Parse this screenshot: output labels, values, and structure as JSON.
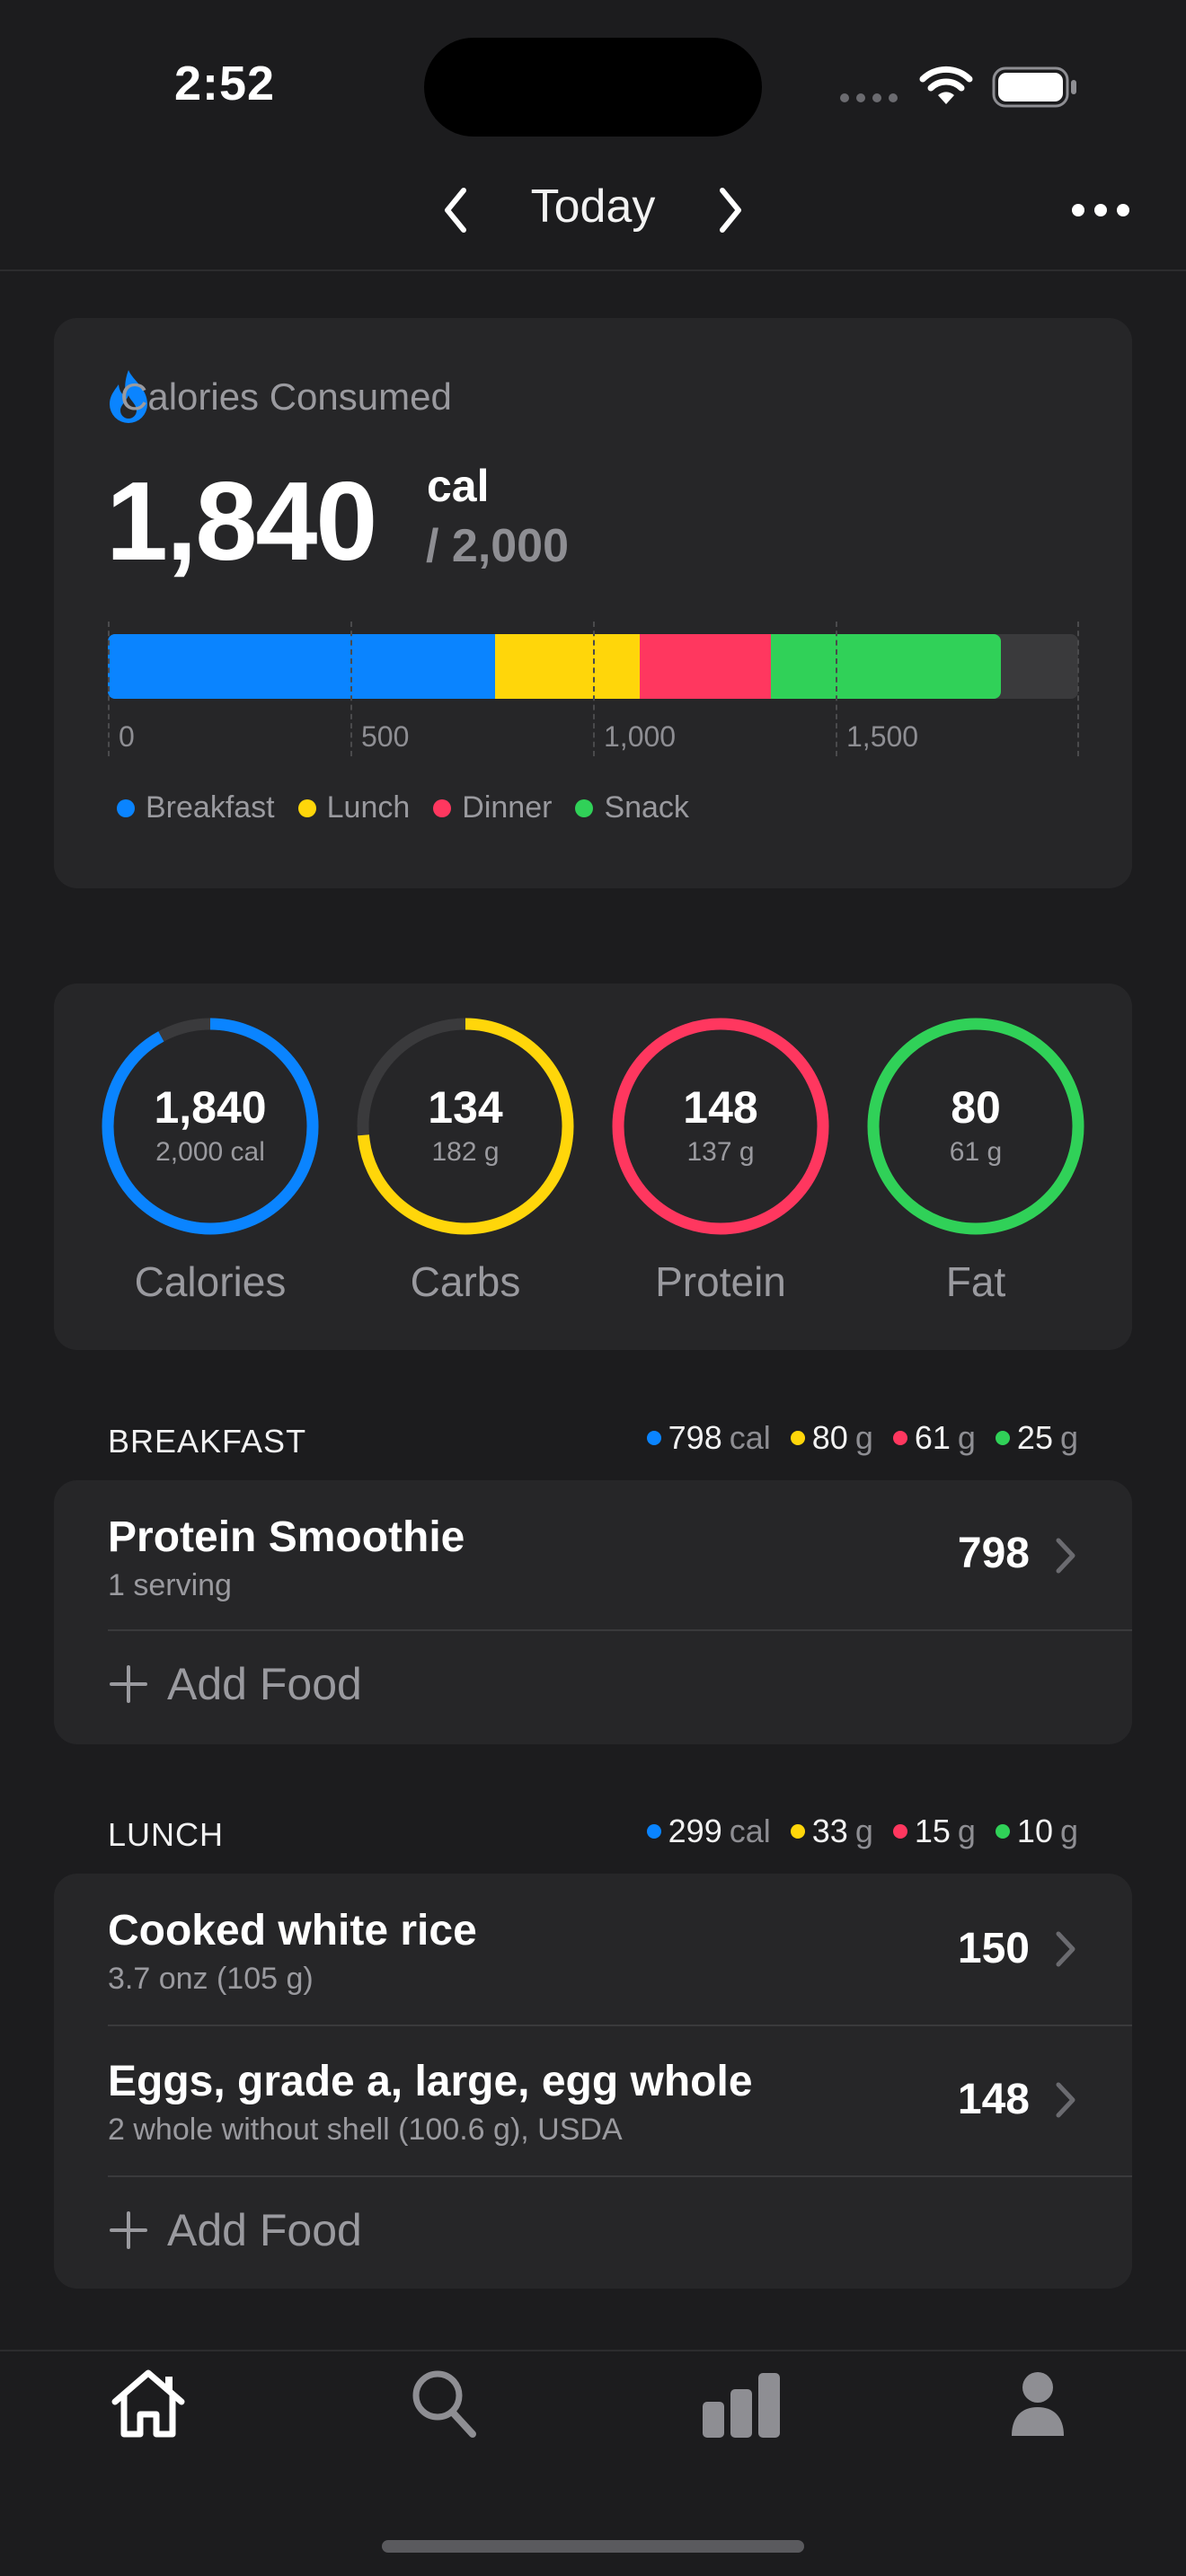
{
  "status_bar": {
    "time": "2:52"
  },
  "nav": {
    "title": "Today"
  },
  "calories_card": {
    "header": "Calories Consumed",
    "consumed": "1,840",
    "unit": "cal",
    "goal": "/ 2,000",
    "ticks": [
      "0",
      "500",
      "1,000",
      "1,500"
    ],
    "legend": [
      {
        "label": "Breakfast",
        "color": "#0a84ff"
      },
      {
        "label": "Lunch",
        "color": "#ffd60a"
      },
      {
        "label": "Dinner",
        "color": "#ff375f"
      },
      {
        "label": "Snack",
        "color": "#30d158"
      }
    ],
    "bar_segments_cal": [
      798,
      299,
      269,
      474
    ],
    "bar_max": 2000
  },
  "rings": [
    {
      "value": "1,840",
      "goal": "2,000 cal",
      "label": "Calories",
      "color": "#0a84ff",
      "progress": 0.92
    },
    {
      "value": "134",
      "goal": "182 g",
      "label": "Carbs",
      "color": "#ffd60a",
      "progress": 0.736
    },
    {
      "value": "148",
      "goal": "137 g",
      "label": "Protein",
      "color": "#ff375f",
      "progress": 1.0
    },
    {
      "value": "80",
      "goal": "61 g",
      "label": "Fat",
      "color": "#30d158",
      "progress": 1.0
    }
  ],
  "breakfast": {
    "title": "BREAKFAST",
    "stats": [
      {
        "num": "798",
        "unit": "cal",
        "color": "#0a84ff"
      },
      {
        "num": "80",
        "unit": "g",
        "color": "#ffd60a"
      },
      {
        "num": "61",
        "unit": "g",
        "color": "#ff375f"
      },
      {
        "num": "25",
        "unit": "g",
        "color": "#30d158"
      }
    ],
    "items": [
      {
        "name": "Protein Smoothie",
        "sub": "1 serving",
        "cal": "798"
      }
    ],
    "add_label": "Add Food"
  },
  "lunch": {
    "title": "LUNCH",
    "stats": [
      {
        "num": "299",
        "unit": "cal",
        "color": "#0a84ff"
      },
      {
        "num": "33",
        "unit": "g",
        "color": "#ffd60a"
      },
      {
        "num": "15",
        "unit": "g",
        "color": "#ff375f"
      },
      {
        "num": "10",
        "unit": "g",
        "color": "#30d158"
      }
    ],
    "items": [
      {
        "name": "Cooked white rice",
        "sub": "3.7 onz (105 g)",
        "cal": "150"
      },
      {
        "name": "Eggs, grade a, large, egg whole",
        "sub": "2 whole without shell (100.6 g), USDA",
        "cal": "148"
      }
    ],
    "add_label": "Add Food"
  },
  "tab_bar": {
    "tabs": [
      {
        "icon": "home-icon",
        "active": true
      },
      {
        "icon": "search-icon",
        "active": false
      },
      {
        "icon": "stats-icon",
        "active": false
      },
      {
        "icon": "profile-icon",
        "active": false
      }
    ]
  }
}
